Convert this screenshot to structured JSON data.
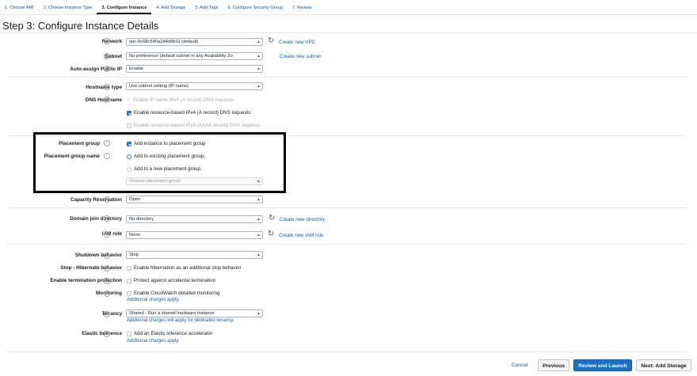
{
  "tabs": [
    {
      "label": "1. Choose AMI"
    },
    {
      "label": "2. Choose Instance Type"
    },
    {
      "label": "3. Configure Instance"
    },
    {
      "label": "4. Add Storage"
    },
    {
      "label": "5. Add Tags"
    },
    {
      "label": "6. Configure Security Group"
    },
    {
      "label": "7. Review"
    }
  ],
  "active_tab": 2,
  "page_title": "Step 3: Configure Instance Details",
  "info_glyph": "i",
  "fields": {
    "network": {
      "label": "Network",
      "value": "vpc-0c68c540a2d4d9b11 (default)",
      "link": "Create new VPC"
    },
    "subnet": {
      "label": "Subnet",
      "value": "No preference (default subnet in any Availability Zo",
      "link": "Create new subnet"
    },
    "public_ip": {
      "label": "Auto-assign Public IP",
      "value": "Enable"
    },
    "hostname_type": {
      "label": "Hostname type",
      "value": "Use subnet setting (IP name)"
    },
    "dns_hostname": {
      "label": "DNS Hostname",
      "options": [
        "Enable IP name IPv4 (A record) DNS requests",
        "Enable resource-based IPv4 (A record) DNS requests",
        "Enable resource-based IPv6 (AAAA record) DNS requests"
      ]
    },
    "placement_group": {
      "label": "Placement group",
      "option": "Add instance to placement group"
    },
    "placement_group_name": {
      "label": "Placement group name",
      "options": [
        "Add to existing placement group.",
        "Add to a new placement group."
      ],
      "select_placeholder": "Choose placement group"
    },
    "capacity_reservation": {
      "label": "Capacity Reservation",
      "value": "Open"
    },
    "domain_join": {
      "label": "Domain join directory",
      "value": "No directory",
      "link": "Create new directory"
    },
    "iam_role": {
      "label": "IAM role",
      "value": "None",
      "link": "Create new IAM role"
    },
    "shutdown": {
      "label": "Shutdown behavior",
      "value": "Stop"
    },
    "hibernate": {
      "label": "Stop - Hibernate behavior",
      "option": "Enable hibernation as an additional stop behavior"
    },
    "termination": {
      "label": "Enable termination protection",
      "option": "Protect against accidental termination"
    },
    "monitoring": {
      "label": "Monitoring",
      "option": "Enable CloudWatch detailed monitoring",
      "note": "Additional charges apply."
    },
    "tenancy": {
      "label": "Tenancy",
      "value": "Shared - Run a shared hardware instance",
      "note": "Additional charges will apply for dedicated tenancy."
    },
    "elastic_inference": {
      "label": "Elastic Inference",
      "option": "Add an Elastic Inference accelerator",
      "note": "Additional charges apply."
    }
  },
  "buttons": {
    "cancel": "Cancel",
    "previous": "Previous",
    "review_launch": "Review and Launch",
    "next": "Next: Add Storage"
  },
  "colors": {
    "primary": "#1a6fc9",
    "link": "#0a61b4",
    "highlight_border": "#000000"
  }
}
